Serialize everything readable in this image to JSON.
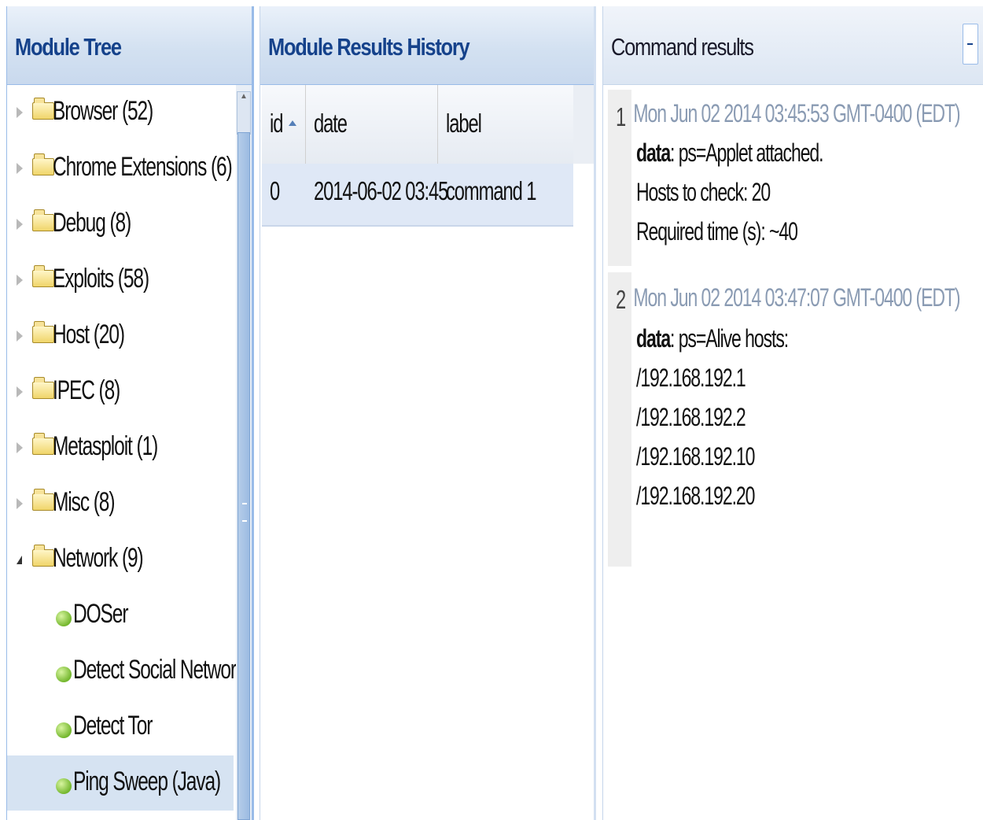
{
  "module_tree": {
    "title": "Module Tree",
    "items": [
      {
        "label": "Browser (52)",
        "type": "folder",
        "expanded": false
      },
      {
        "label": "Chrome Extensions (6)",
        "type": "folder",
        "expanded": false
      },
      {
        "label": "Debug (8)",
        "type": "folder",
        "expanded": false
      },
      {
        "label": "Exploits (58)",
        "type": "folder",
        "expanded": false
      },
      {
        "label": "Host (20)",
        "type": "folder",
        "expanded": false
      },
      {
        "label": "IPEC (8)",
        "type": "folder",
        "expanded": false
      },
      {
        "label": "Metasploit (1)",
        "type": "folder",
        "expanded": false
      },
      {
        "label": "Misc (8)",
        "type": "folder",
        "expanded": false
      },
      {
        "label": "Network (9)",
        "type": "folder",
        "expanded": true
      },
      {
        "label": "DOSer",
        "type": "module"
      },
      {
        "label": "Detect Social Networks",
        "type": "module"
      },
      {
        "label": "Detect Tor",
        "type": "module"
      },
      {
        "label": "Ping Sweep (Java)",
        "type": "module",
        "selected": true
      }
    ]
  },
  "history": {
    "title": "Module Results History",
    "columns": [
      "id",
      "date",
      "label"
    ],
    "rows": [
      {
        "id": "0",
        "date": "2014-06-02 03:45",
        "label": "command 1"
      }
    ]
  },
  "command_results": {
    "title": "Command results",
    "results": [
      {
        "num": "1",
        "date": "Mon Jun 02 2014 03:45:53 GMT-0400 (EDT)",
        "data_key": "data",
        "lines": [
          "ps=Applet attached.",
          "Hosts to check: 20",
          "Required time (s): ~40"
        ]
      },
      {
        "num": "2",
        "date": "Mon Jun 02 2014 03:47:07 GMT-0400 (EDT)",
        "data_key": "data",
        "lines": [
          "ps=Alive hosts:",
          "/192.168.192.1",
          "/192.168.192.2",
          "/192.168.192.10",
          "/192.168.192.20"
        ]
      }
    ]
  },
  "colors": {
    "header_title": "#15428b",
    "panel_border": "#99bbe8",
    "selected_row": "#d6e3f2",
    "date_text": "#8a9bb3"
  }
}
